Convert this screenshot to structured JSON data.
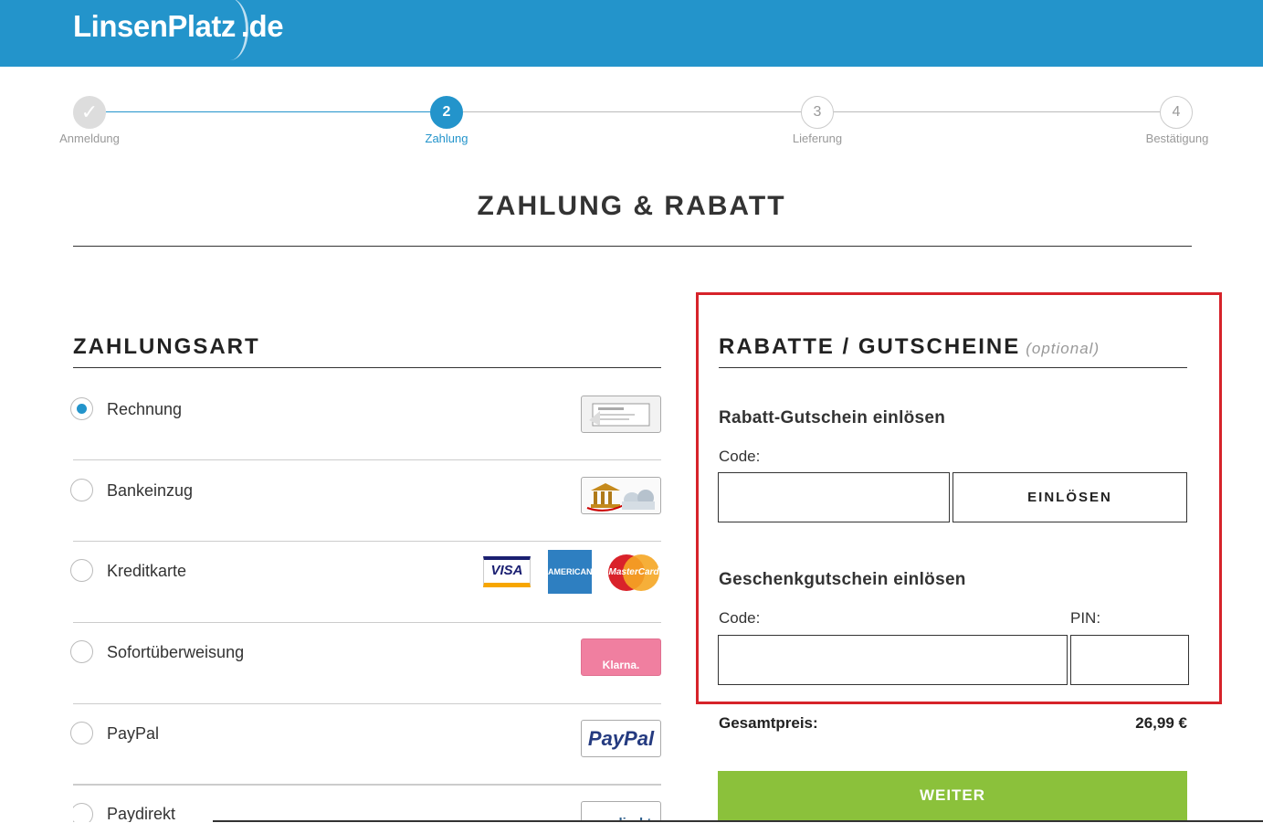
{
  "header": {
    "logo_main": "LinsenPlatz",
    "logo_tld": ".de",
    "bg_color": "#2394cb"
  },
  "steps": [
    {
      "number": "✓",
      "label": "Anmeldung",
      "state": "done"
    },
    {
      "number": "2",
      "label": "Zahlung",
      "state": "current"
    },
    {
      "number": "3",
      "label": "Lieferung",
      "state": "upcoming"
    },
    {
      "number": "4",
      "label": "Bestätigung",
      "state": "upcoming"
    }
  ],
  "page_title": "ZAHLUNG & RABATT",
  "payment": {
    "title": "ZAHLUNGSART",
    "selected": "Rechnung",
    "methods": [
      {
        "label": "Rechnung",
        "logo_icon": "invoice-icon"
      },
      {
        "label": "Bankeinzug",
        "logo_icon": "bank-icon"
      },
      {
        "label": "Kreditkarte",
        "logos": [
          "VISA",
          "AMERICAN EXPRESS",
          "MasterCard"
        ]
      },
      {
        "label": "Sofortüberweisung",
        "logo_text": "Klarna."
      },
      {
        "label": "PayPal",
        "logo_text": "PayPal"
      },
      {
        "label": "Paydirekt",
        "logo_text": "paydirekt"
      }
    ]
  },
  "discounts": {
    "title": "RABATTE / GUTSCHEINE",
    "optional": "(optional)",
    "coupon": {
      "title": "Rabatt-Gutschein einlösen",
      "code_label": "Code:",
      "code_value": "",
      "button": "EINLÖSEN"
    },
    "gift": {
      "title": "Geschenkgutschein einlösen",
      "code_label": "Code:",
      "code_value": "",
      "pin_label": "PIN:",
      "pin_value": ""
    },
    "highlight_color": "#d6232a"
  },
  "total": {
    "label": "Gesamtpreis:",
    "value": "26,99 €"
  },
  "continue_button": {
    "label": "WEITER",
    "color": "#8bc13b"
  }
}
